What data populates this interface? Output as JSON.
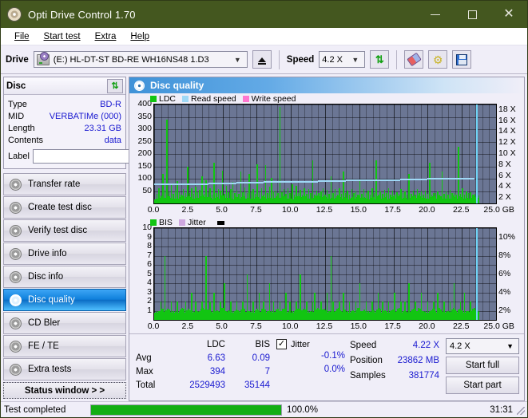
{
  "window": {
    "title": "Opti Drive Control 1.70",
    "icon": "disc-icon",
    "minimize": "minimize-icon",
    "maximize": "maximize-icon",
    "close": "close-icon"
  },
  "menu": [
    {
      "label": "File"
    },
    {
      "label": "Start test"
    },
    {
      "label": "Extra"
    },
    {
      "label": "Help"
    }
  ],
  "toolbar": {
    "drive_label": "Drive",
    "drive_value": "(E:)  HL-DT-ST BD-RE  WH16NS48 1.D3",
    "eject_icon": "eject-icon",
    "speed_label": "Speed",
    "speed_value": "4.2 X",
    "refresh_icon": "refresh-arrows-icon",
    "eraser_icon": "eraser-icon",
    "tools_icon": "gears-icon",
    "save_icon": "save-disk-icon"
  },
  "disc": {
    "header": "Disc",
    "refresh_icon": "refresh-arrows-icon",
    "rows": [
      {
        "key": "Type",
        "value": "BD-R"
      },
      {
        "key": "MID",
        "value": "VERBATIMe (000)"
      },
      {
        "key": "Length",
        "value": "23.31 GB"
      },
      {
        "key": "Contents",
        "value": "data"
      }
    ],
    "label_key": "Label",
    "label_value": "",
    "label_placeholder": "",
    "label_button_icon": "cd-icon"
  },
  "sidebar": {
    "items": [
      {
        "label": "Transfer rate",
        "icon": "disc-icon",
        "selected": false
      },
      {
        "label": "Create test disc",
        "icon": "disc-icon",
        "selected": false
      },
      {
        "label": "Verify test disc",
        "icon": "disc-icon",
        "selected": false
      },
      {
        "label": "Drive info",
        "icon": "disc-icon",
        "selected": false
      },
      {
        "label": "Disc info",
        "icon": "disc-icon",
        "selected": false
      },
      {
        "label": "Disc quality",
        "icon": "disc-icon",
        "selected": true
      },
      {
        "label": "CD Bler",
        "icon": "disc-icon",
        "selected": false
      },
      {
        "label": "FE / TE",
        "icon": "disc-icon",
        "selected": false
      },
      {
        "label": "Extra tests",
        "icon": "disc-icon",
        "selected": false
      }
    ],
    "status_button": "Status window > >"
  },
  "panel": {
    "title": "Disc quality",
    "icon": "disc-quality-icon"
  },
  "chart_data": [
    {
      "type": "bar",
      "title": "LDC / Read speed",
      "xlabel": "GB",
      "ylabel": "LDC",
      "xlim": [
        0,
        25
      ],
      "ylim": [
        0,
        400
      ],
      "y2lim": [
        0,
        18
      ],
      "y2label": "X",
      "grid": true,
      "legend_position": "top-left",
      "legend": [
        {
          "name": "LDC",
          "color": "#12c512"
        },
        {
          "name": "Read speed",
          "color": "#9fd8f6"
        },
        {
          "name": "Write speed",
          "color": "#ff77d0"
        }
      ],
      "xticks": [
        "0.0",
        "2.5",
        "5.0",
        "7.5",
        "10.0",
        "12.5",
        "15.0",
        "17.5",
        "20.0",
        "22.5",
        "25.0 GB"
      ],
      "yticks": [
        400,
        350,
        300,
        250,
        200,
        150,
        100,
        50
      ],
      "y2ticks": [
        "18 X",
        "16 X",
        "14 X",
        "12 X",
        "10 X",
        "8 X",
        "6 X",
        "4 X",
        "2 X"
      ],
      "series": [
        {
          "name": "LDC",
          "color": "#12c512",
          "x": [
            0.15,
            0.3,
            0.45,
            0.6,
            0.75,
            0.9,
            1.05,
            1.2,
            1.35,
            1.5,
            1.65,
            1.8,
            1.95,
            2.1,
            2.25,
            2.4,
            2.55,
            2.7,
            2.85,
            3.0,
            3.15,
            3.3,
            3.45,
            3.6,
            3.75,
            3.9,
            4.05,
            4.2,
            4.35,
            4.5,
            4.65,
            4.8,
            4.95,
            5.1,
            5.25,
            5.4,
            5.55,
            5.7,
            5.85,
            6.0,
            6.15,
            6.3,
            6.45,
            6.6,
            6.75,
            6.9,
            7.05,
            7.2,
            7.35,
            7.5,
            7.65,
            7.8,
            7.95,
            8.1,
            8.25,
            8.4,
            8.55,
            8.7,
            8.85,
            9.0,
            9.15,
            9.3,
            9.45,
            9.6,
            9.75,
            9.9,
            10.05,
            10.2,
            10.35,
            10.5,
            10.65,
            10.8,
            10.95,
            11.1,
            11.25,
            11.4,
            11.55,
            11.7,
            11.85,
            12.0,
            12.15,
            12.3,
            12.45,
            12.6,
            12.75,
            12.9,
            13.05,
            13.2,
            13.35,
            13.5,
            13.65,
            13.8,
            13.95,
            14.1,
            14.25,
            14.4,
            14.55,
            14.7,
            14.85,
            15.0,
            15.15,
            15.3,
            15.45,
            15.6,
            15.75,
            15.9,
            16.05,
            16.2,
            16.35,
            16.5,
            16.65,
            16.8,
            16.95,
            17.1,
            17.25,
            17.4,
            17.55,
            17.7,
            17.85,
            18.0,
            18.15,
            18.3,
            18.45,
            18.6,
            18.75,
            18.9,
            19.05,
            19.2,
            19.35,
            19.5,
            19.65,
            19.8,
            19.95,
            20.1,
            20.25,
            20.4,
            20.55,
            20.7,
            20.85,
            21.0,
            21.15,
            21.3,
            21.45,
            21.6,
            21.75,
            21.9,
            22.05,
            22.2,
            22.35,
            22.5,
            22.65,
            22.8,
            22.95,
            23.1,
            23.25,
            23.4,
            23.55,
            23.7
          ],
          "values": [
            40,
            62,
            35,
            120,
            55,
            340,
            48,
            75,
            41,
            52,
            90,
            46,
            38,
            58,
            44,
            150,
            42,
            64,
            39,
            70,
            45,
            57,
            110,
            41,
            96,
            47,
            62,
            38,
            165,
            44,
            58,
            52,
            135,
            40,
            73,
            46,
            60,
            88,
            42,
            54,
            39,
            130,
            47,
            66,
            43,
            120,
            51,
            58,
            41,
            160,
            45,
            62,
            38,
            155,
            44,
            70,
            105,
            48,
            52,
            42,
            390,
            46,
            58,
            40,
            62,
            44,
            80,
            38,
            72,
            42,
            55,
            36,
            64,
            40,
            58,
            44,
            175,
            38,
            52,
            42,
            48,
            62,
            38,
            56,
            40,
            110,
            44,
            58,
            36,
            62,
            40,
            130,
            42,
            54,
            38,
            60,
            44,
            48,
            36,
            90,
            40,
            58,
            42,
            52,
            38,
            62,
            44,
            175,
            38,
            48,
            40,
            56,
            42,
            64,
            36,
            52,
            38,
            46,
            40,
            58,
            44,
            50,
            36,
            120,
            40,
            54,
            38,
            60,
            42,
            48,
            36,
            52,
            40,
            165,
            38,
            44,
            42,
            50,
            36,
            130,
            40,
            48,
            38,
            56,
            42,
            44,
            36,
            230,
            40,
            62,
            38,
            50,
            42,
            46,
            36,
            40,
            38,
            34
          ]
        },
        {
          "name": "Read speed",
          "color": "#9fd8f6",
          "x": [
            0.0,
            2.0,
            4.0,
            6.0,
            8.0,
            10.0,
            12.0,
            14.0,
            16.0,
            18.0,
            20.0,
            22.0,
            23.4
          ],
          "values": [
            3.6,
            3.7,
            3.8,
            3.9,
            4.0,
            4.1,
            4.2,
            4.3,
            4.4,
            4.5,
            4.6,
            4.7,
            4.75
          ]
        }
      ],
      "cursor_x": 23.55
    },
    {
      "type": "bar",
      "title": "BIS / Jitter",
      "xlabel": "GB",
      "ylabel": "BIS",
      "xlim": [
        0,
        25
      ],
      "ylim": [
        0,
        10
      ],
      "y2lim": [
        0,
        10
      ],
      "y2label": "%",
      "grid": true,
      "legend_position": "top-left",
      "legend": [
        {
          "name": "BIS",
          "color": "#12c512"
        },
        {
          "name": "Jitter",
          "color": "#cfa8e0"
        }
      ],
      "xticks": [
        "0.0",
        "2.5",
        "5.0",
        "7.5",
        "10.0",
        "12.5",
        "15.0",
        "17.5",
        "20.0",
        "22.5",
        "25.0 GB"
      ],
      "yticks": [
        10,
        9,
        8,
        7,
        6,
        5,
        4,
        3,
        2,
        1
      ],
      "y2ticks": [
        "10%",
        "8%",
        "6%",
        "4%",
        "2%"
      ],
      "series": [
        {
          "name": "BIS",
          "color": "#12c512",
          "x": [
            0.15,
            0.3,
            0.45,
            0.6,
            0.75,
            0.9,
            1.05,
            1.2,
            1.35,
            1.5,
            1.65,
            1.8,
            1.95,
            2.1,
            2.25,
            2.4,
            2.55,
            2.7,
            2.85,
            3.0,
            3.15,
            3.3,
            3.45,
            3.6,
            3.75,
            3.9,
            4.05,
            4.2,
            4.35,
            4.5,
            4.65,
            4.8,
            4.95,
            5.1,
            5.25,
            5.4,
            5.55,
            5.7,
            5.85,
            6.0,
            6.15,
            6.3,
            6.45,
            6.6,
            6.75,
            6.9,
            7.05,
            7.2,
            7.35,
            7.5,
            7.65,
            7.8,
            7.95,
            8.1,
            8.25,
            8.4,
            8.55,
            8.7,
            8.85,
            9.0,
            9.15,
            9.3,
            9.45,
            9.6,
            9.75,
            9.9,
            10.05,
            10.2,
            10.35,
            10.5,
            10.65,
            10.8,
            10.95,
            11.1,
            11.25,
            11.4,
            11.55,
            11.7,
            11.85,
            12.0,
            12.15,
            12.3,
            12.45,
            12.6,
            12.75,
            12.9,
            13.05,
            13.2,
            13.35,
            13.5,
            13.65,
            13.8,
            13.95,
            14.1,
            14.25,
            14.4,
            14.55,
            14.7,
            14.85,
            15.0,
            15.15,
            15.3,
            15.45,
            15.6,
            15.75,
            15.9,
            16.05,
            16.2,
            16.35,
            16.5,
            16.65,
            16.8,
            16.95,
            17.1,
            17.25,
            17.4,
            17.55,
            17.7,
            17.85,
            18.0,
            18.15,
            18.3,
            18.45,
            18.6,
            18.75,
            18.9,
            19.05,
            19.2,
            19.35,
            19.5,
            19.65,
            19.8,
            19.95,
            20.1,
            20.25,
            20.4,
            20.55,
            20.7,
            20.85,
            21.0,
            21.15,
            21.3,
            21.45,
            21.6,
            21.75,
            21.9,
            22.05,
            22.2,
            22.35,
            22.5,
            22.65,
            22.8,
            22.95,
            23.1,
            23.25,
            23.4,
            23.55,
            23.7
          ],
          "values": [
            1,
            1,
            2,
            1,
            7,
            1,
            1,
            2,
            1,
            1,
            2,
            1,
            1,
            1,
            2,
            1,
            1,
            3,
            1,
            2,
            1,
            1,
            2,
            1,
            7,
            1,
            2,
            1,
            3,
            1,
            1,
            2,
            1,
            4,
            1,
            1,
            2,
            1,
            1,
            2,
            1,
            1,
            2,
            1,
            5,
            1,
            1,
            2,
            1,
            1,
            3,
            1,
            2,
            1,
            1,
            4,
            1,
            2,
            1,
            1,
            2,
            1,
            1,
            3,
            1,
            2,
            1,
            1,
            2,
            1,
            5,
            1,
            1,
            2,
            1,
            1,
            2,
            3,
            1,
            1,
            2,
            1,
            1,
            3,
            1,
            7,
            2,
            1,
            1,
            2,
            1,
            3,
            1,
            1,
            2,
            1,
            1,
            2,
            1,
            4,
            1,
            1,
            2,
            1,
            1,
            2,
            1,
            1,
            3,
            1,
            2,
            1,
            1,
            2,
            1,
            1,
            3,
            1,
            1,
            2,
            1,
            2,
            1,
            4,
            1,
            1,
            2,
            1,
            1,
            3,
            1,
            1,
            2,
            1,
            1,
            2,
            1,
            3,
            1,
            1,
            2,
            1,
            1,
            2,
            1,
            4,
            1,
            1,
            2,
            1,
            3,
            1,
            1,
            2,
            1,
            1,
            2,
            1,
            1,
            2
          ]
        }
      ],
      "cursor_x": 23.55
    }
  ],
  "stats": {
    "col_headers": {
      "ldc": "LDC",
      "bis": "BIS"
    },
    "rows": [
      {
        "label": "Avg",
        "ldc": "6.63",
        "bis": "0.09"
      },
      {
        "label": "Max",
        "ldc": "394",
        "bis": "7"
      },
      {
        "label": "Total",
        "ldc": "2529493",
        "bis": "35144"
      }
    ],
    "jitter": {
      "label": "Jitter",
      "checked": true,
      "check_glyph": "✓",
      "avg": "-0.1%",
      "max": "0.0%",
      "total": ""
    },
    "right": {
      "speed_label": "Speed",
      "speed_value": "4.22 X",
      "position_label": "Position",
      "position_value": "23862 MB",
      "samples_label": "Samples",
      "samples_value": "381774",
      "speed_select": "4.2 X",
      "start_full": "Start full",
      "start_part": "Start part"
    }
  },
  "statusbar": {
    "text": "Test completed",
    "percent_label": "100.0%",
    "progress": 100,
    "time": "31:31"
  },
  "colors": {
    "title_bg": "#44571f",
    "ldc_green": "#12c512",
    "read_speed": "#9fd8f6",
    "write_speed": "#ff77d0",
    "jitter": "#cfa8e0",
    "plot_bg": "#6b7694",
    "value_blue": "#1a1ad0",
    "selected_nav": "#0e7fdb"
  }
}
